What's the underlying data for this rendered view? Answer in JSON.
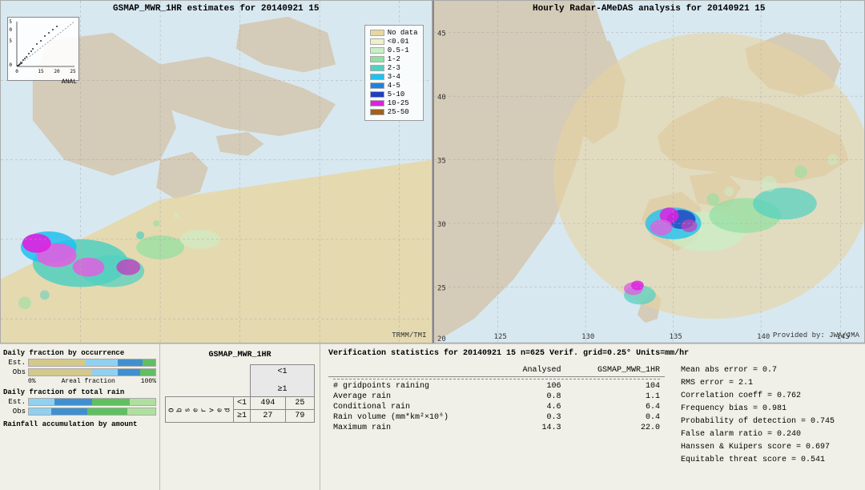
{
  "left_map": {
    "title": "GSMAP_MWR_1HR estimates for 20140921 15",
    "credit": "TRMM/TMI",
    "scatter_label": "ANAL",
    "scatter_axis_x": [
      "0",
      "15",
      "20",
      "25"
    ],
    "legend_items": [
      {
        "label": "No data",
        "color": "#e8d8a0"
      },
      {
        "label": "<0.01",
        "color": "#f0f0c8"
      },
      {
        "label": "0.5-1",
        "color": "#c8f0c8"
      },
      {
        "label": "1-2",
        "color": "#90e0a0"
      },
      {
        "label": "2-3",
        "color": "#50d0c0"
      },
      {
        "label": "3-4",
        "color": "#20c0f0"
      },
      {
        "label": "4-5",
        "color": "#2080e0"
      },
      {
        "label": "5-10",
        "color": "#2040c0"
      },
      {
        "label": "10-25",
        "color": "#e020e0"
      },
      {
        "label": "25-50",
        "color": "#a06020"
      }
    ]
  },
  "right_map": {
    "title": "Hourly Radar-AMeDAS analysis for 20140921 15",
    "credit": "Provided by: JWA/JMA",
    "lat_labels": [
      "45",
      "40",
      "35",
      "30",
      "25",
      "20"
    ],
    "lon_labels": [
      "125",
      "130",
      "135",
      "140",
      "145"
    ]
  },
  "bar_charts": {
    "section1_title": "Daily fraction by occurrence",
    "section2_title": "Daily fraction of total rain",
    "section3_title": "Rainfall accumulation by amount",
    "est_label": "Est.",
    "obs_label": "Obs",
    "axis_start": "0%",
    "axis_end": "100%",
    "axis_mid": "Areal fraction"
  },
  "contingency": {
    "title": "GSMAP_MWR_1HR",
    "col_lt1": "<1",
    "col_ge1": "≥1",
    "row_lt1": "<1",
    "row_ge1": "≥1",
    "obs_label": "O\nb\ns\ne\nr\nv\ne\nd",
    "val_a": "494",
    "val_b": "25",
    "val_c": "27",
    "val_d": "79"
  },
  "verification": {
    "title": "Verification statistics for 20140921 15  n=625  Verif. grid=0.25°  Units=mm/hr",
    "col_analysed": "Analysed",
    "col_gsmap": "GSMAP_MWR_1HR",
    "rows": [
      {
        "label": "# gridpoints raining",
        "analysed": "106",
        "gsmap": "104"
      },
      {
        "label": "Average rain",
        "analysed": "0.8",
        "gsmap": "1.1"
      },
      {
        "label": "Conditional rain",
        "analysed": "4.6",
        "gsmap": "6.4"
      },
      {
        "label": "Rain volume (mm*km²×10⁶)",
        "analysed": "0.3",
        "gsmap": "0.4"
      },
      {
        "label": "Maximum rain",
        "analysed": "14.3",
        "gsmap": "22.0"
      }
    ],
    "scores": [
      {
        "label": "Mean abs error",
        "value": "= 0.7"
      },
      {
        "label": "RMS error",
        "value": "= 2.1"
      },
      {
        "label": "Correlation coeff",
        "value": "= 0.762"
      },
      {
        "label": "Frequency bias",
        "value": "= 0.981"
      },
      {
        "label": "Probability of detection",
        "value": "= 0.745"
      },
      {
        "label": "False alarm ratio",
        "value": "= 0.240"
      },
      {
        "label": "Hanssen & Kuipers score",
        "value": "= 0.697"
      },
      {
        "label": "Equitable threat score",
        "value": "= 0.541"
      }
    ]
  }
}
